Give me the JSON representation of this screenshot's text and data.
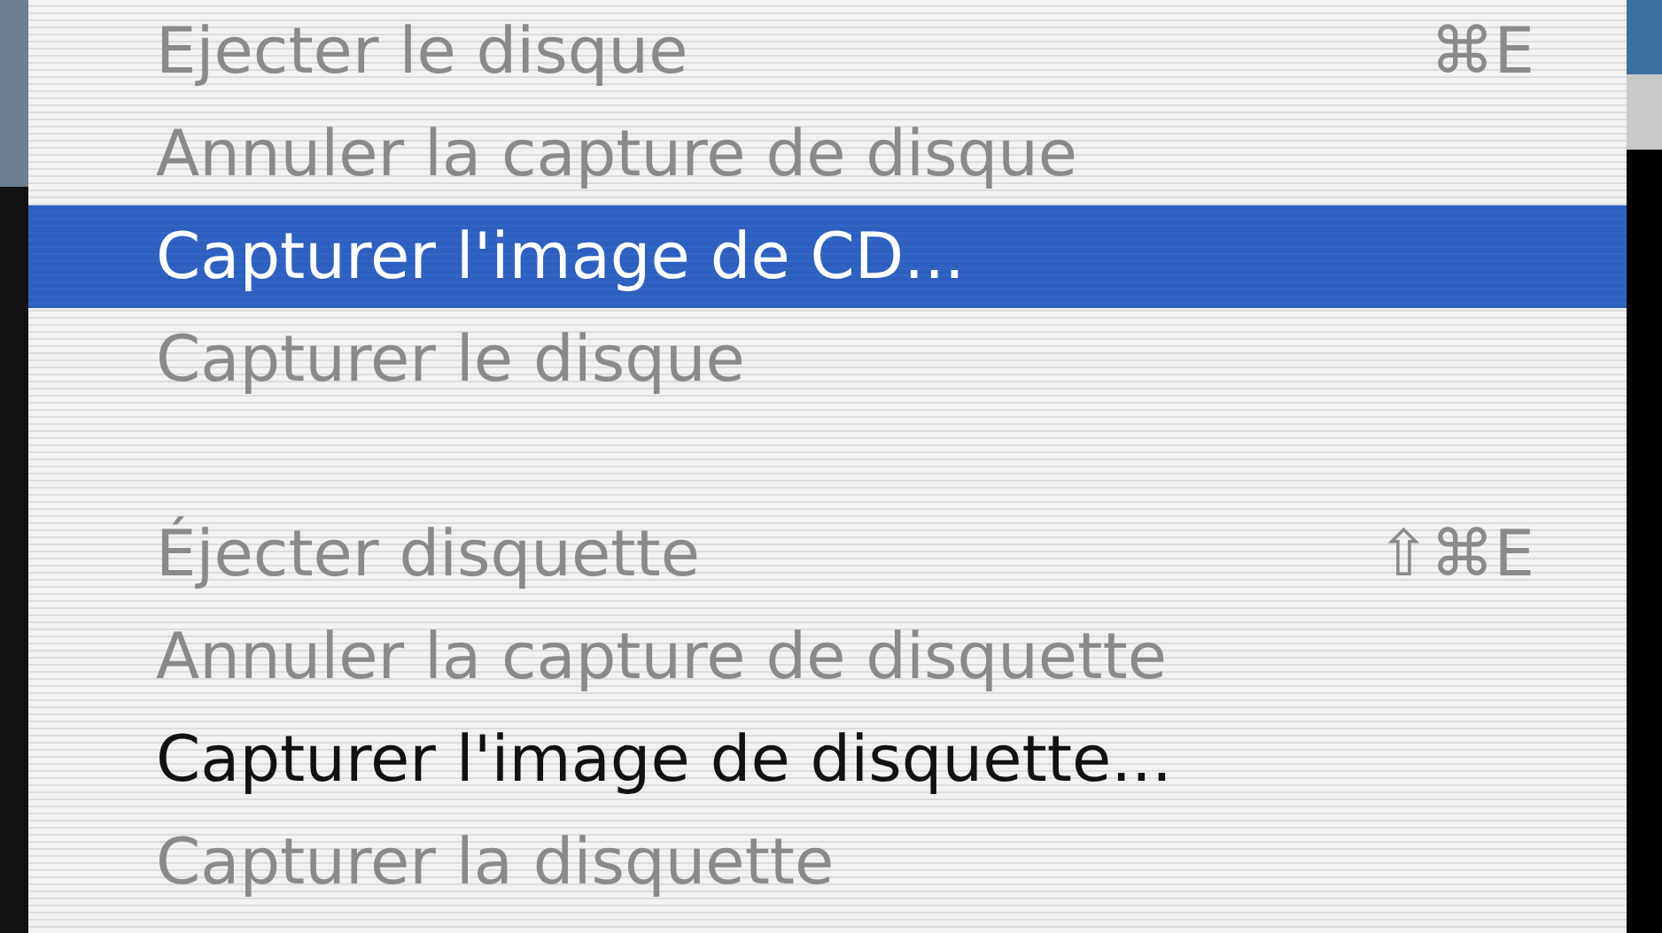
{
  "menu": {
    "items": [
      {
        "kind": "item",
        "label": "Ejecter le disque",
        "shortcut": "⌘E",
        "disabled": true,
        "selected": false
      },
      {
        "kind": "item",
        "label": "Annuler la capture de disque",
        "disabled": true,
        "selected": false
      },
      {
        "kind": "item",
        "label": "Capturer l'image de CD...",
        "disabled": false,
        "selected": true
      },
      {
        "kind": "item",
        "label": "Capturer le disque",
        "disabled": true,
        "selected": false
      },
      {
        "kind": "separator"
      },
      {
        "kind": "item",
        "label": "Éjecter disquette",
        "shortcut": "⇧⌘E",
        "disabled": true,
        "selected": false
      },
      {
        "kind": "item",
        "label": "Annuler la capture de disquette",
        "disabled": true,
        "selected": false
      },
      {
        "kind": "item",
        "label": "Capturer l'image de disquette...",
        "disabled": false,
        "selected": false
      },
      {
        "kind": "item",
        "label": "Capturer la disquette",
        "disabled": true,
        "selected": false
      }
    ]
  }
}
